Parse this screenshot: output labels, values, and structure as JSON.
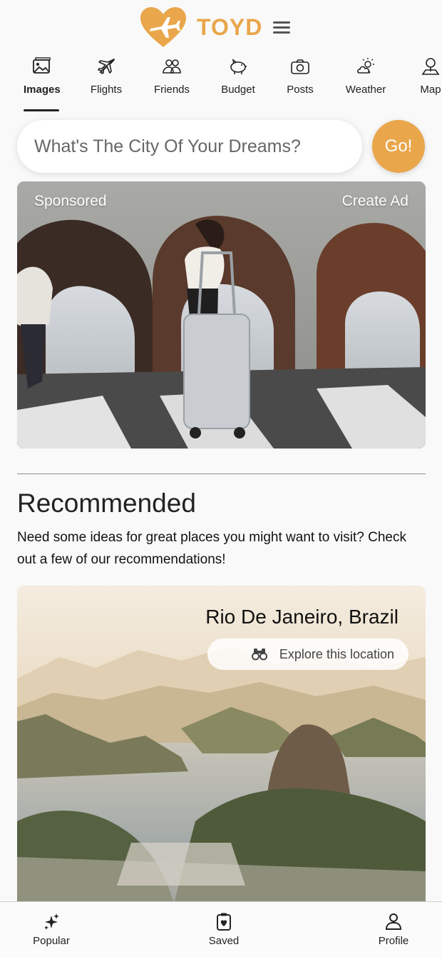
{
  "header": {
    "brand": "TOYD",
    "brand_color": "#e9a64b"
  },
  "tabs": [
    {
      "label": "Images",
      "icon": "image-icon",
      "active": true
    },
    {
      "label": "Flights",
      "icon": "airplane-icon"
    },
    {
      "label": "Friends",
      "icon": "friends-icon"
    },
    {
      "label": "Budget",
      "icon": "piggy-bank-icon"
    },
    {
      "label": "Posts",
      "icon": "camera-icon"
    },
    {
      "label": "Weather",
      "icon": "weather-icon"
    },
    {
      "label": "Map",
      "icon": "map-pin-icon"
    }
  ],
  "search": {
    "placeholder": "What's The City Of Your Dreams?",
    "go_label": "Go!"
  },
  "ad": {
    "sponsored_label": "Sponsored",
    "create_ad_label": "Create Ad"
  },
  "recommended": {
    "title": "Recommended",
    "description": "Need some ideas for great places you might want to visit? Check out a few of our recommendations!",
    "card": {
      "title": "Rio De Janeiro, Brazil",
      "explore_label": "Explore this location"
    }
  },
  "bottom_nav": [
    {
      "label": "Popular",
      "icon": "sparkle-icon"
    },
    {
      "label": "Saved",
      "icon": "clipboard-heart-icon"
    },
    {
      "label": "Profile",
      "icon": "user-icon"
    }
  ]
}
